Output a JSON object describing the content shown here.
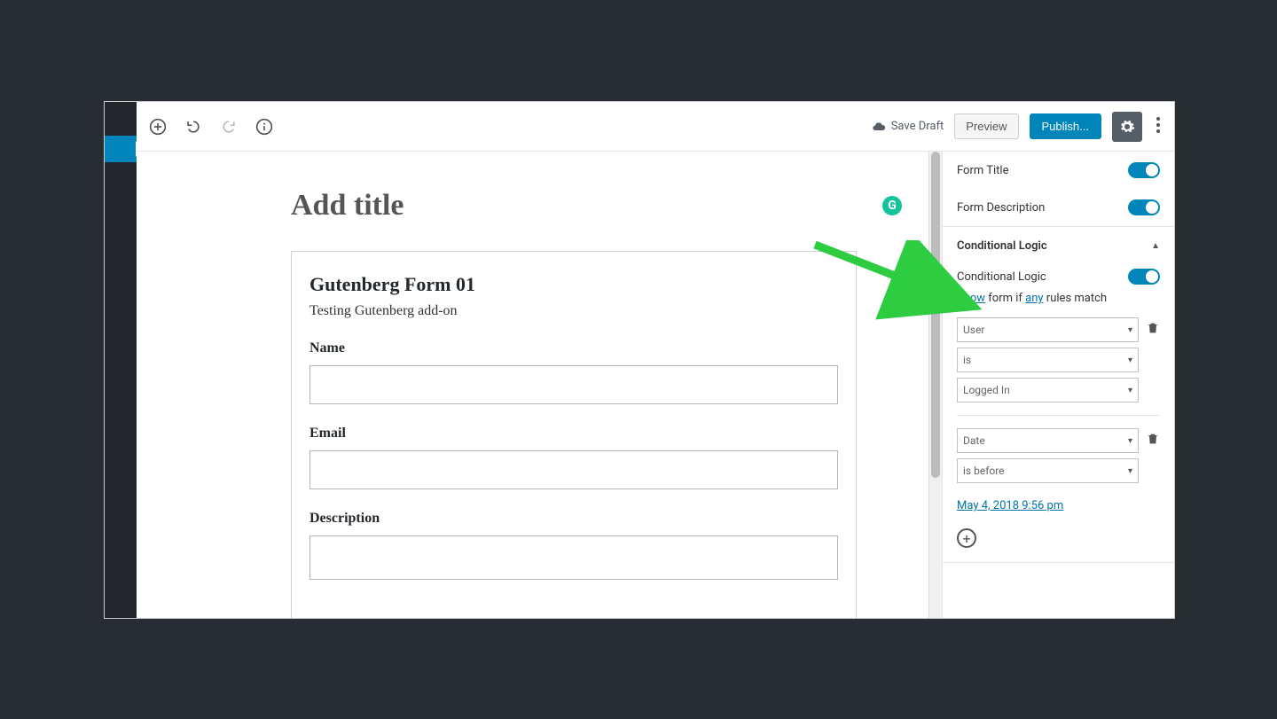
{
  "topbar": {
    "save_draft": "Save Draft",
    "preview": "Preview",
    "publish": "Publish..."
  },
  "editor": {
    "title_placeholder": "Add title",
    "form": {
      "title": "Gutenberg Form 01",
      "description": "Testing Gutenberg add-on",
      "fields": [
        {
          "label": "Name"
        },
        {
          "label": "Email"
        },
        {
          "label": "Description"
        }
      ]
    }
  },
  "sidebar": {
    "form_title_label": "Form Title",
    "form_description_label": "Form Description",
    "conditional_logic_header": "Conditional Logic",
    "conditional_logic_label": "Conditional Logic",
    "rule_sentence": {
      "show": "Show",
      "middle": " form if ",
      "any": "any",
      "end": " rules match"
    },
    "rules": [
      {
        "field": "User",
        "operator": "is",
        "value": "Logged In"
      },
      {
        "field": "Date",
        "operator": "is before"
      }
    ],
    "date_value": "May 4, 2018 9:56 pm"
  }
}
